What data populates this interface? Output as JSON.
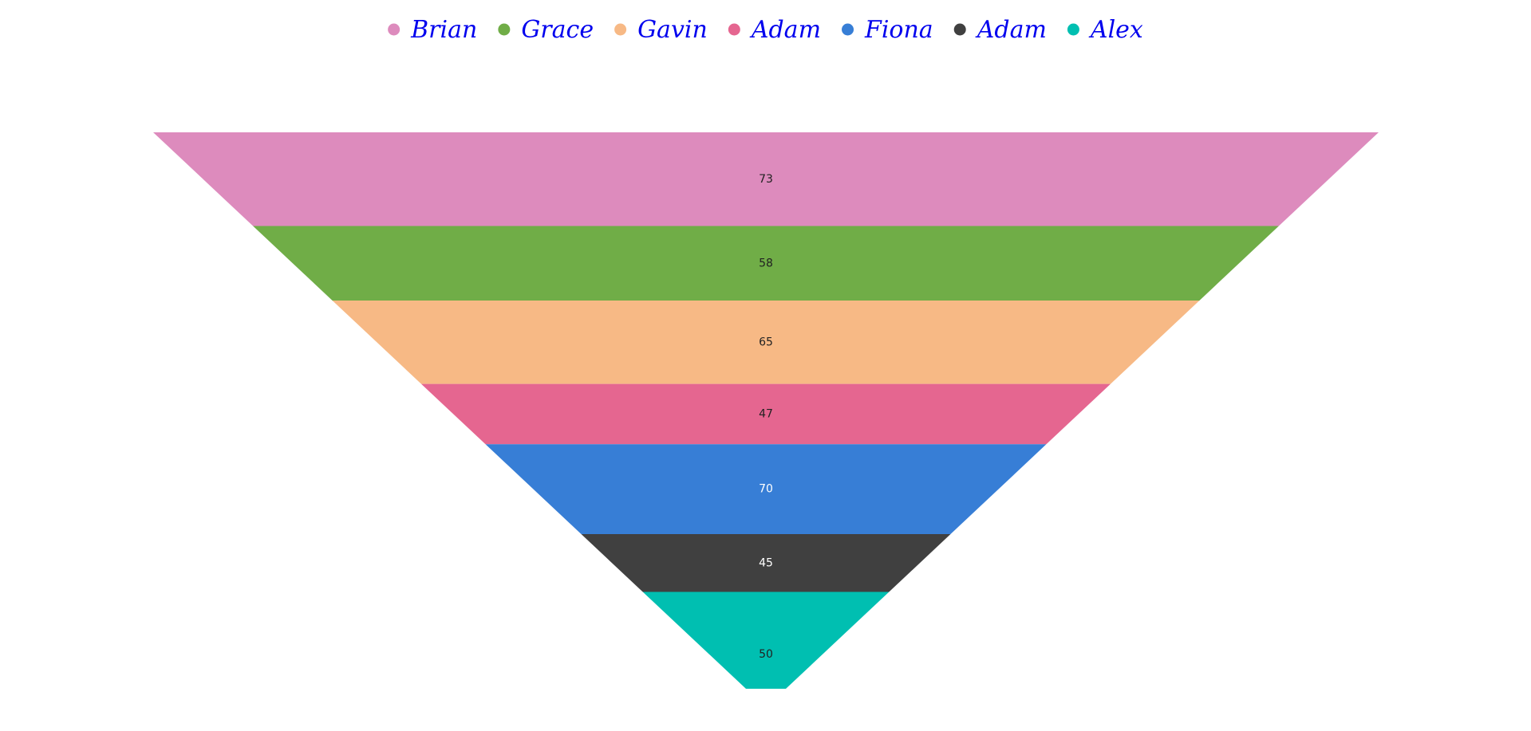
{
  "chart_data": {
    "type": "funnel",
    "categories": [
      "Brian",
      "Grace",
      "Gavin",
      "Adam",
      "Fiona",
      "Adam",
      "Alex"
    ],
    "values": [
      73,
      58,
      65,
      47,
      70,
      45,
      50
    ],
    "colors": [
      "#dd8bbd",
      "#70ad47",
      "#f7b985",
      "#e56690",
      "#377ed6",
      "#404040",
      "#00bfb1"
    ],
    "label_colors": [
      "#222222",
      "#222222",
      "#222222",
      "#222222",
      "#ffffff",
      "#ffffff",
      "#222222"
    ],
    "legend": {
      "position": "top",
      "text_color": "#0000ee"
    }
  }
}
